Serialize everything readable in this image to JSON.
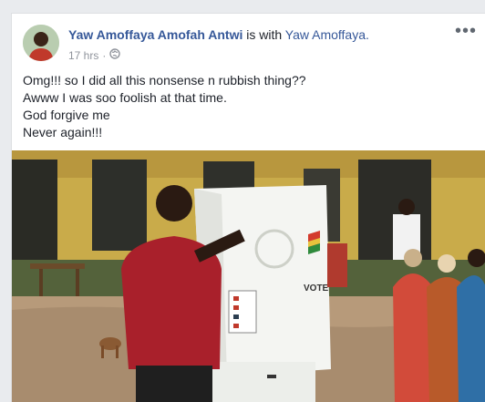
{
  "post": {
    "author": "Yaw Amoffaya Amofah Antwi",
    "with_text": "is with",
    "tagged": "Yaw Amoffaya.",
    "time": "17 hrs",
    "separator": "·",
    "more_label": "•••",
    "lines": [
      "Omg!!! so I did all this nonsense n rubbish thing??",
      "Awww I was soo foolish at that time.",
      "God forgive me",
      "Never again!!!"
    ]
  },
  "photo": {
    "ballot_label": "VOTE"
  },
  "icons": {
    "privacy": "globe-icon",
    "more": "more-options-icon"
  }
}
